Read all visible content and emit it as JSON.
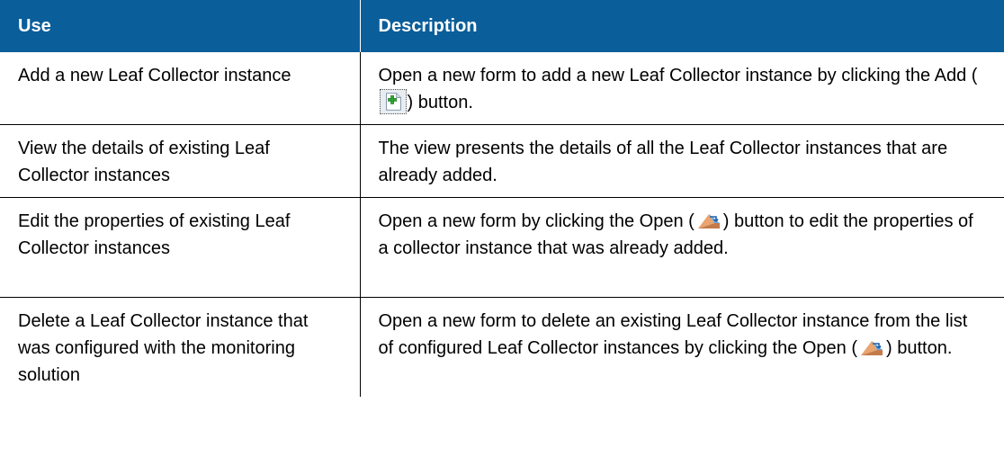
{
  "table": {
    "headers": {
      "use": "Use",
      "description": "Description"
    },
    "rows": [
      {
        "use": "Add a new Leaf Collector instance",
        "desc_before": "Open a new form to add a new Leaf Collector instance by clicking the Add (",
        "desc_after": ") button.",
        "icon": "add-icon"
      },
      {
        "use": "View the details of existing Leaf Collector instances",
        "desc": "The view presents the details of all the Leaf Collector instances that are already added."
      },
      {
        "use": "Edit the properties of existing Leaf Collector instances",
        "desc_before": "Open a new form by clicking the Open (",
        "desc_after": ") button to edit the properties of a collector instance that was already added.",
        "icon": "open-icon"
      },
      {
        "use": "Delete a Leaf Collector instance that was configured with the monitoring solution",
        "desc_before": "Open a new form to delete an existing Leaf Collector instance from the list of configured Leaf Collector instances by clicking the Open (",
        "desc_after": ") button.",
        "icon": "open-icon"
      }
    ]
  },
  "colors": {
    "header_bg": "#0a5e9a",
    "header_text": "#ffffff",
    "border": "#000000"
  }
}
